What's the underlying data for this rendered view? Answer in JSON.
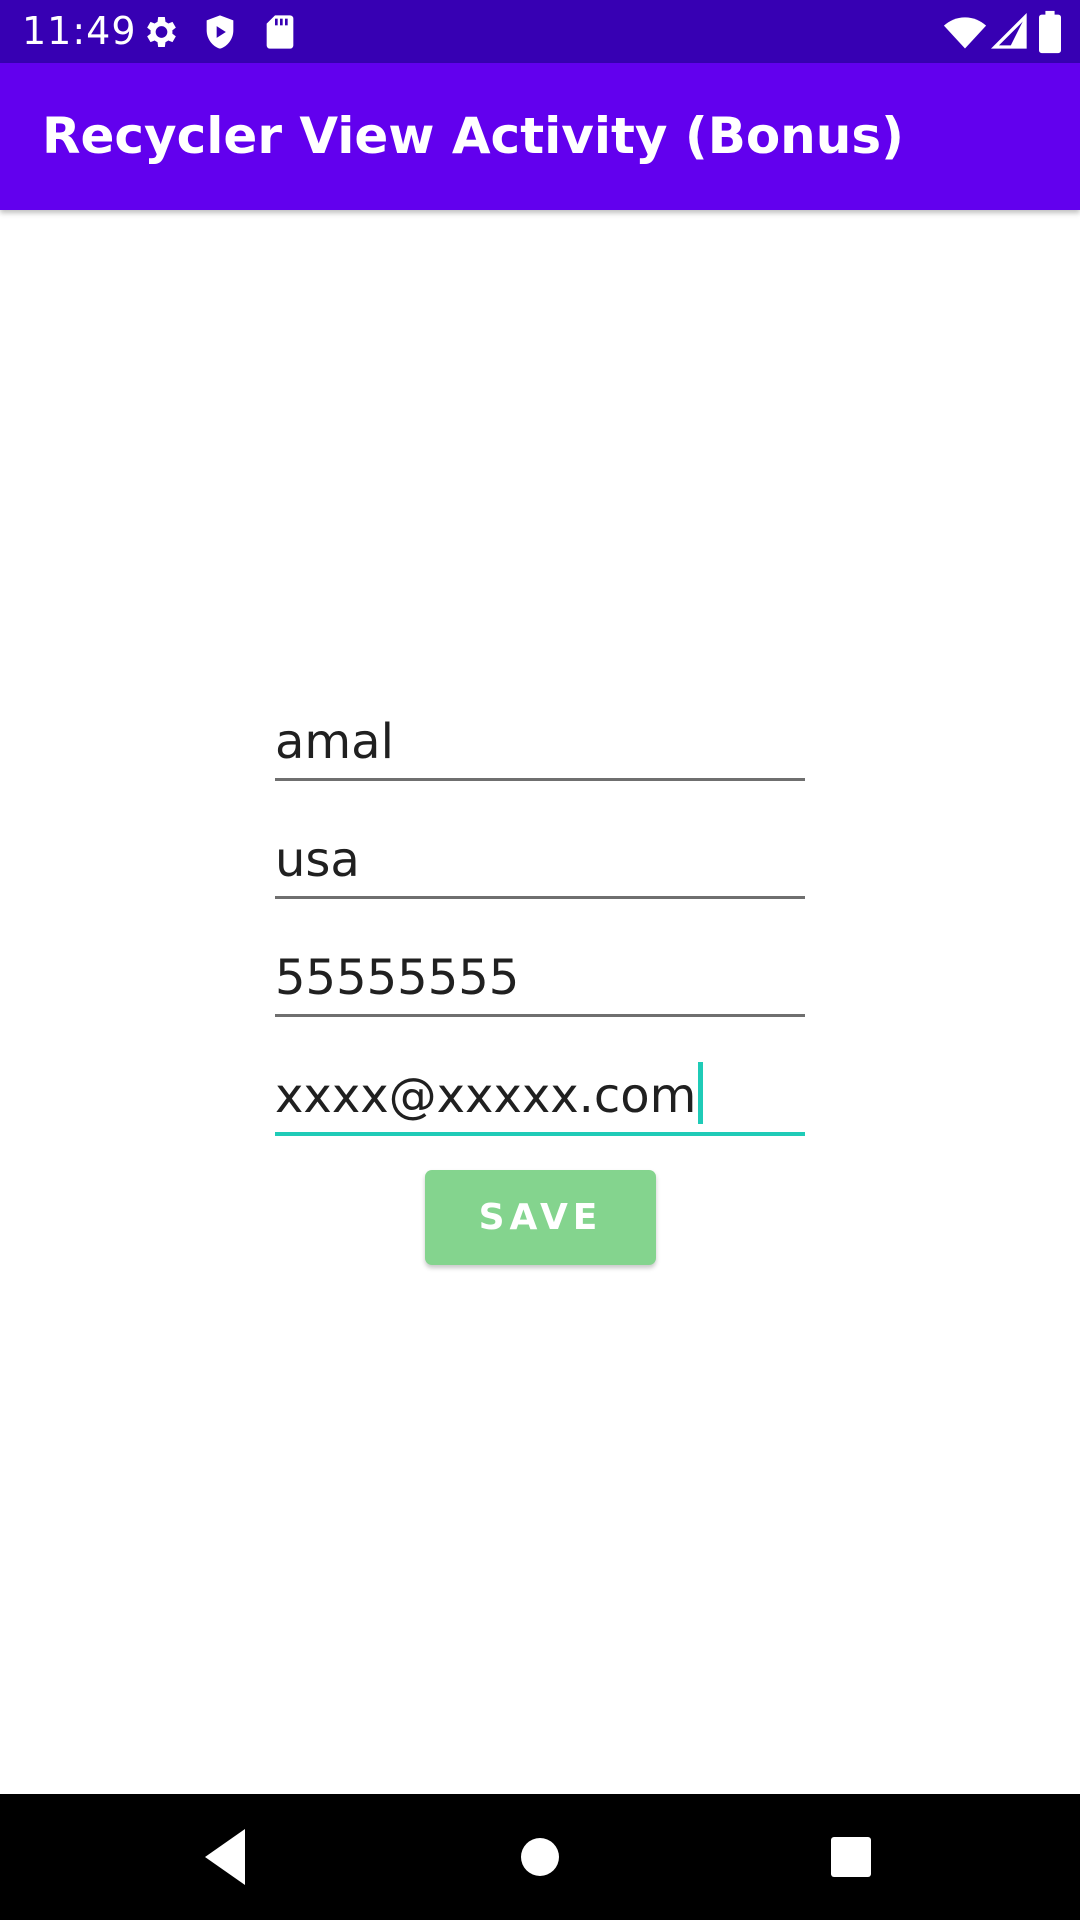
{
  "status_bar": {
    "time": "11:49",
    "icons": [
      "gear-icon",
      "shield-play-icon",
      "sd-card-icon",
      "wifi-icon",
      "signal-icon",
      "battery-icon"
    ],
    "background": "#3700b3"
  },
  "app_bar": {
    "title": "Recycler View Activity (Bonus)",
    "background": "#6200ee"
  },
  "form": {
    "fields": [
      {
        "name": "name",
        "value": "amal"
      },
      {
        "name": "country",
        "value": "usa"
      },
      {
        "name": "phone",
        "value": "55555555"
      },
      {
        "name": "email",
        "value": "xxxx@xxxxx.com",
        "focused": true
      }
    ],
    "save_label": "SAVE",
    "save_color": "#84d48e",
    "focus_color": "#1fcbb7"
  },
  "nav_bar": {
    "buttons": [
      "back-icon",
      "home-icon",
      "recents-icon"
    ]
  }
}
